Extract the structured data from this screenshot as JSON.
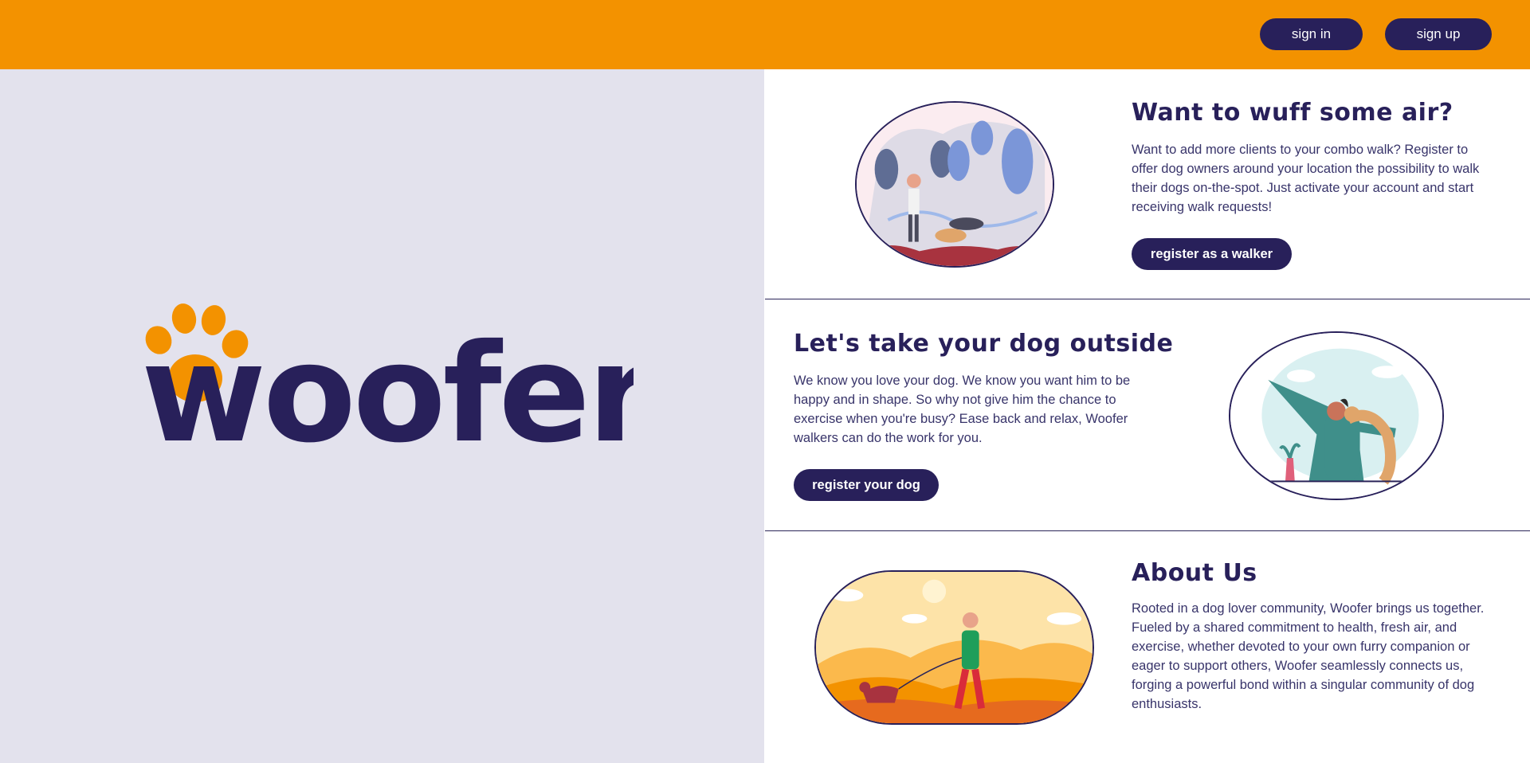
{
  "header": {
    "signin_label": "sign in",
    "signup_label": "sign up"
  },
  "logo": {
    "text": "woofer",
    "icon": "paw-icon"
  },
  "sections": [
    {
      "title": "Want to wuff some air?",
      "text": "Want to add more clients to your combo walk? Register to offer dog owners around your location the possibility to walk their dogs on-the-spot. Just activate your account and start receiving walk requests!",
      "button": "register as a walker",
      "illustration": "walker-with-dogs-illustration"
    },
    {
      "title": "Let's take your dog outside",
      "text": "We know you love your dog. We know you want him to be happy and in shape. So why not give him the chance to exercise when you're busy? Ease back and relax, Woofer walkers can do the work for you.",
      "button": "register your dog",
      "illustration": "man-hugging-dog-illustration"
    },
    {
      "title": "About Us",
      "text": "Rooted in a dog lover community, Woofer brings us together. Fueled by a shared commitment to health, fresh air, and exercise, whether devoted to your own furry companion or eager to support others, Woofer seamlessly connects us, forging a powerful bond within a singular community of dog enthusiasts.",
      "illustration": "autumn-walk-illustration"
    }
  ],
  "colors": {
    "header": "#f39200",
    "primary": "#28205a",
    "left_panel": "#e3e2ed",
    "paw": "#f39200"
  }
}
